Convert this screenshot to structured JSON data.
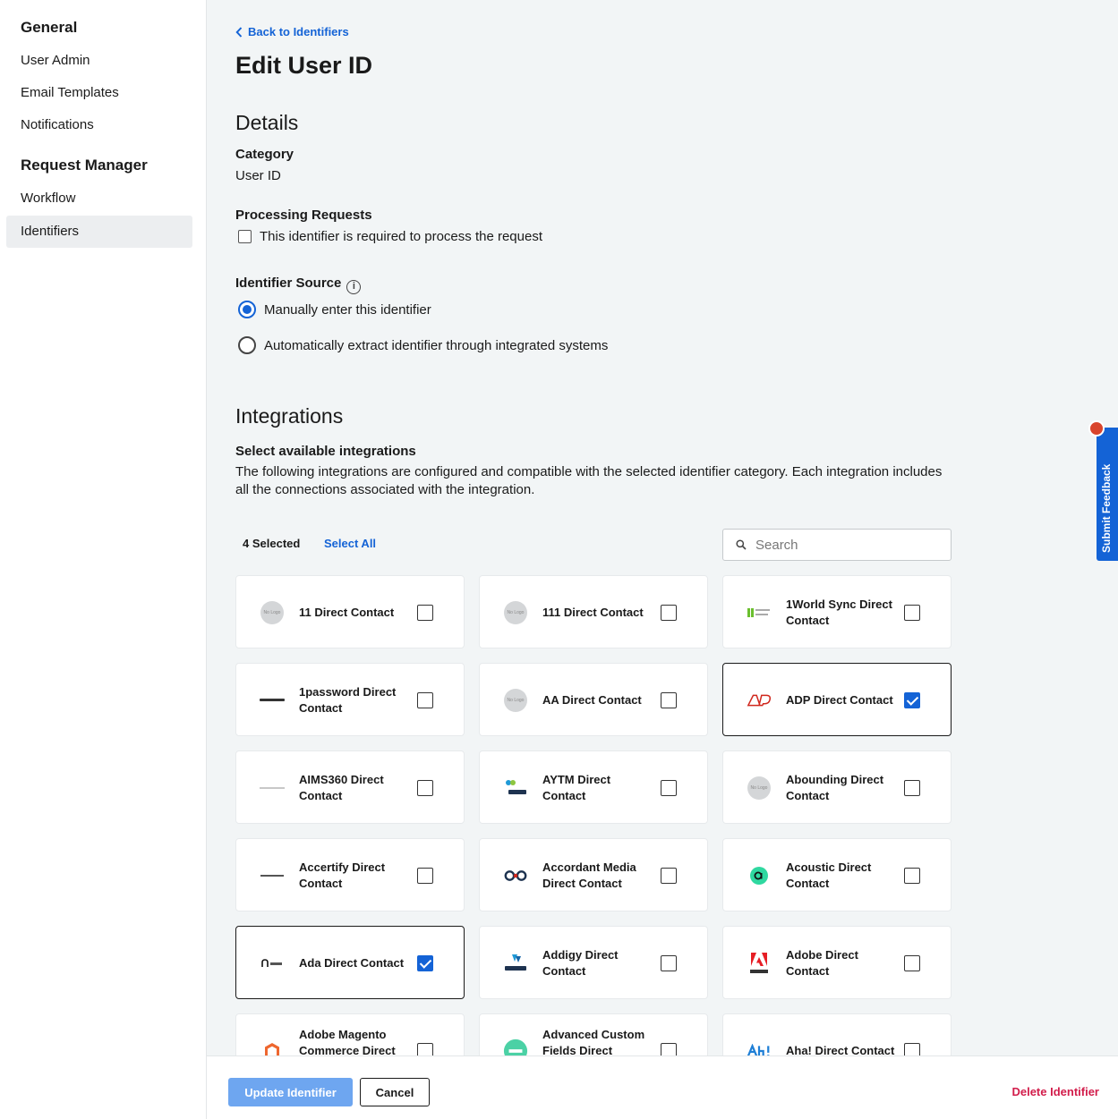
{
  "sidebar": {
    "sections": [
      {
        "heading": "General",
        "items": [
          "User Admin",
          "Email Templates",
          "Notifications"
        ]
      },
      {
        "heading": "Request Manager",
        "items": [
          "Workflow",
          "Identifiers"
        ]
      }
    ],
    "active_item": "Identifiers"
  },
  "header": {
    "back_link": "Back to Identifiers",
    "title": "Edit User ID"
  },
  "details": {
    "title": "Details",
    "category_label": "Category",
    "category_value": "User ID",
    "processing_label": "Processing Requests",
    "processing_checkbox": "This identifier is required to process the request",
    "processing_checked": false,
    "source_label": "Identifier Source",
    "source_options": [
      {
        "label": "Manually enter this identifier",
        "checked": true
      },
      {
        "label": "Automatically extract identifier through integrated systems",
        "checked": false
      }
    ]
  },
  "integrations": {
    "title": "Integrations",
    "subtitle": "Select available integrations",
    "description": "The following integrations are configured and compatible with the selected identifier category. Each integration includes all the connections associated with the integration.",
    "selected_count": "4 Selected",
    "select_all": "Select All",
    "search_placeholder": "Search",
    "cards": [
      {
        "name": "11 Direct Contact",
        "checked": false,
        "logo": "no-logo"
      },
      {
        "name": "111 Direct Contact",
        "checked": false,
        "logo": "no-logo"
      },
      {
        "name": "1World Sync Direct Contact",
        "checked": false,
        "logo": "1worldsync"
      },
      {
        "name": "1password Direct Contact",
        "checked": false,
        "logo": "1password"
      },
      {
        "name": "AA Direct Contact",
        "checked": false,
        "logo": "no-logo"
      },
      {
        "name": "ADP Direct Contact",
        "checked": true,
        "logo": "adp"
      },
      {
        "name": "AIMS360 Direct Contact",
        "checked": false,
        "logo": "aims360"
      },
      {
        "name": "AYTM Direct Contact",
        "checked": false,
        "logo": "aytm"
      },
      {
        "name": "Abounding Direct Contact",
        "checked": false,
        "logo": "no-logo"
      },
      {
        "name": "Accertify Direct Contact",
        "checked": false,
        "logo": "accertify"
      },
      {
        "name": "Accordant Media Direct Contact",
        "checked": false,
        "logo": "accordant"
      },
      {
        "name": "Acoustic Direct Contact",
        "checked": false,
        "logo": "acoustic"
      },
      {
        "name": "Ada Direct Contact",
        "checked": true,
        "logo": "ada"
      },
      {
        "name": "Addigy Direct Contact",
        "checked": false,
        "logo": "addigy"
      },
      {
        "name": "Adobe Direct Contact",
        "checked": false,
        "logo": "adobe"
      },
      {
        "name": "Adobe Magento Commerce Direct Contact",
        "checked": false,
        "logo": "magento"
      },
      {
        "name": "Advanced Custom Fields Direct Contact",
        "checked": false,
        "logo": "acf"
      },
      {
        "name": "Aha! Direct Contact",
        "checked": false,
        "logo": "aha"
      }
    ]
  },
  "footer": {
    "update_button": "Update Identifier",
    "cancel_button": "Cancel",
    "delete_link": "Delete Identifier"
  },
  "feedback_tab": "Submit Feedback",
  "colors": {
    "accent": "#1463d6",
    "danger": "#d21d4b",
    "background": "#f2f5f6"
  }
}
